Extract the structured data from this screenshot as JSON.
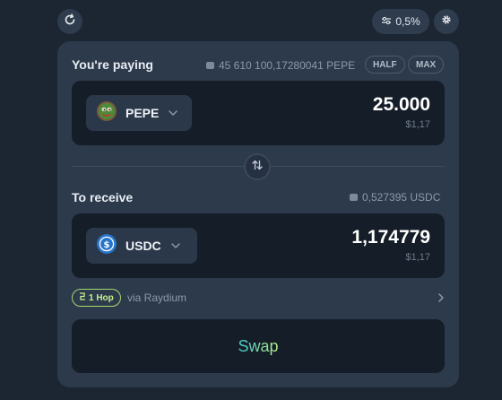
{
  "toolbar": {
    "refresh_icon": "refresh-icon",
    "slippage_icon": "sliders-icon",
    "slippage_value": "0,5%",
    "settings_icon": "gear-icon"
  },
  "paying": {
    "title": "You're paying",
    "balance": "45 610 100,17280041 PEPE",
    "half_label": "HALF",
    "max_label": "MAX",
    "token": "PEPE",
    "amount": "25.000",
    "usd_value": "$1,17"
  },
  "receiving": {
    "title": "To receive",
    "balance": "0,527395 USDC",
    "token": "USDC",
    "amount": "1,174779",
    "usd_value": "$1,17"
  },
  "route": {
    "hops": "1 Hop",
    "via": "via Raydium"
  },
  "swap_label": "Swap",
  "colors": {
    "background": "#1c2532",
    "card": "#2c3a4c",
    "input_box": "#151d28",
    "accent_green": "#b7ef83",
    "accent_teal": "#3fc7d2",
    "usdc_blue": "#2775ca"
  }
}
